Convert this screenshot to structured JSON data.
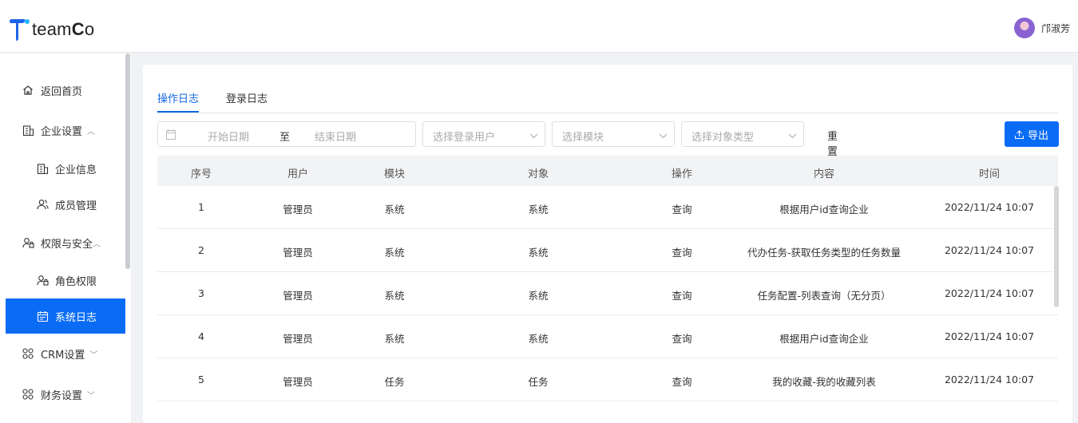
{
  "header": {
    "logo_text_light": "team",
    "logo_text_bold": "C",
    "logo_text_end": "o",
    "username": "邝淑芳"
  },
  "sidebar": {
    "items": [
      {
        "label": "返回首页",
        "icon": "home-icon"
      },
      {
        "label": "企业设置",
        "icon": "building-icon",
        "chevron": "up"
      },
      {
        "label": "企业信息",
        "icon": "building-icon"
      },
      {
        "label": "成员管理",
        "icon": "users-icon"
      },
      {
        "label": "权限与安全",
        "icon": "user-lock-icon",
        "chevron": "up"
      },
      {
        "label": "角色权限",
        "icon": "user-lock-icon"
      },
      {
        "label": "系统日志",
        "icon": "calendar-icon",
        "active": true
      },
      {
        "label": "CRM设置",
        "icon": "grid-icon",
        "chevron": "down"
      },
      {
        "label": "财务设置",
        "icon": "grid-icon",
        "chevron": "down"
      }
    ]
  },
  "tabs": [
    {
      "label": "操作日志",
      "active": true
    },
    {
      "label": "登录日志",
      "active": false
    }
  ],
  "filters": {
    "start_placeholder": "开始日期",
    "separator": "至",
    "end_placeholder": "结束日期",
    "user_placeholder": "选择登录用户",
    "module_placeholder": "选择模块",
    "object_placeholder": "选择对象类型",
    "reset_label": "重置",
    "export_label": "导出"
  },
  "table": {
    "columns": [
      "序号",
      "用户",
      "模块",
      "对象",
      "操作",
      "内容",
      "时间"
    ],
    "rows": [
      [
        "1",
        "管理员",
        "系统",
        "系统",
        "查询",
        "根据用户id查询企业",
        "2022/11/24 10:07"
      ],
      [
        "2",
        "管理员",
        "系统",
        "系统",
        "查询",
        "代办任务-获取任务类型的任务数量",
        "2022/11/24 10:07"
      ],
      [
        "3",
        "管理员",
        "系统",
        "系统",
        "查询",
        "任务配置-列表查询（无分页）",
        "2022/11/24 10:07"
      ],
      [
        "4",
        "管理员",
        "系统",
        "系统",
        "查询",
        "根据用户id查询企业",
        "2022/11/24 10:07"
      ],
      [
        "5",
        "管理员",
        "任务",
        "任务",
        "查询",
        "我的收藏-我的收藏列表",
        "2022/11/24 10:07"
      ]
    ]
  },
  "colors": {
    "accent": "#0a6cf5",
    "tab_active": "#1668e3"
  }
}
